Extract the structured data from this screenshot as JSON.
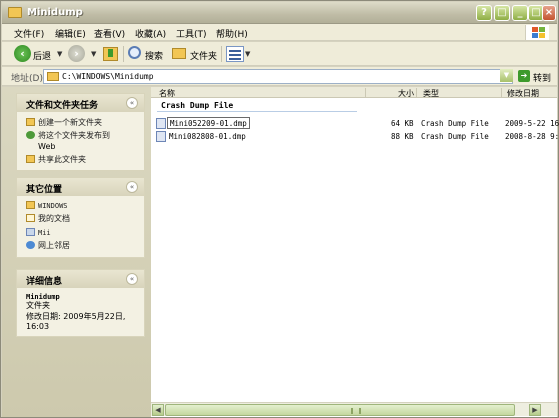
{
  "window": {
    "title": "Minidump"
  },
  "menu": [
    "文件(F)",
    "编辑(E)",
    "查看(V)",
    "收藏(A)",
    "工具(T)",
    "帮助(H)"
  ],
  "toolbar": {
    "back": "后退",
    "search": "搜索",
    "folders": "文件夹"
  },
  "address": {
    "label": "地址(D)",
    "value": "C:\\WINDOWS\\Minidump",
    "go": "转到"
  },
  "tasks": {
    "file_tasks": {
      "title": "文件和文件夹任务",
      "items": [
        "创建一个新文件夹",
        "将这个文件夹发布到",
        "Web",
        "共享此文件夹"
      ]
    },
    "other_places": {
      "title": "其它位置",
      "items": [
        "WINDOWS",
        "我的文档",
        "Mii",
        "网上邻居"
      ]
    },
    "details": {
      "title": "详细信息",
      "name": "Minidump",
      "type": "文件夹",
      "modified_label": "修改日期: 2009年5月22日,",
      "modified_time": "16:03"
    }
  },
  "columns": {
    "name": "名称",
    "size": "大小",
    "type": "类型",
    "modified": "修改日期"
  },
  "group": "Crash Dump File",
  "files": [
    {
      "name": "Mini052209-01.dmp",
      "size": "64 KB",
      "type": "Crash Dump File",
      "modified": "2009-5-22 16"
    },
    {
      "name": "Mini082808-01.dmp",
      "size": "88 KB",
      "type": "Crash Dump File",
      "modified": "2008-8-28 9:"
    }
  ]
}
